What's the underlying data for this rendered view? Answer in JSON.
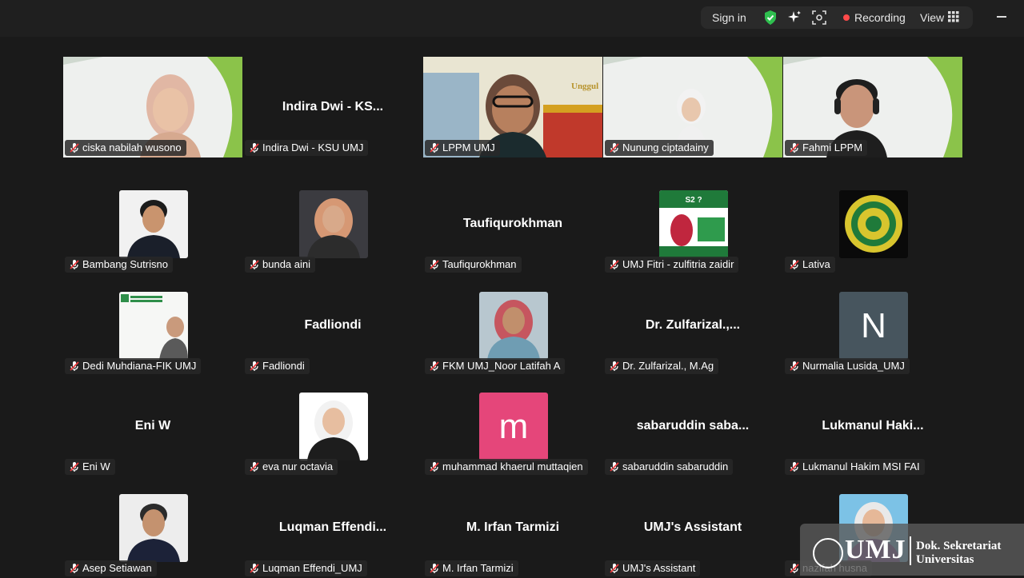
{
  "topbar": {
    "sign_in": "Sign in",
    "recording": "Recording",
    "view": "View"
  },
  "tiles": [
    {
      "name": "ciska nabilah wusono",
      "display": "video",
      "speaking": false
    },
    {
      "name": "Indira Dwi - KSU UMJ",
      "display": "text",
      "big": "Indira Dwi - KS..."
    },
    {
      "name": "LPPM UMJ",
      "display": "video",
      "speaking": true
    },
    {
      "name": "Nunung ciptadainy",
      "display": "video",
      "speaking": false
    },
    {
      "name": "Fahmi LPPM",
      "display": "video",
      "speaking": false
    },
    {
      "name": "Bambang Sutrisno",
      "display": "photo"
    },
    {
      "name": "bunda aini",
      "display": "photo"
    },
    {
      "name": "Taufiqurokhman",
      "display": "text",
      "big": "Taufiqurokhman"
    },
    {
      "name": "UMJ Fitri - zulfitria zaidir",
      "display": "photo"
    },
    {
      "name": "Lativa",
      "display": "photo"
    },
    {
      "name": "Dedi Muhdiana-FIK UMJ",
      "display": "photo"
    },
    {
      "name": "Fadliondi",
      "display": "text",
      "big": "Fadliondi"
    },
    {
      "name": "FKM UMJ_Noor Latifah A",
      "display": "photo"
    },
    {
      "name": "Dr. Zulfarizal., M.Ag",
      "display": "text",
      "big": "Dr. Zulfarizal.,..."
    },
    {
      "name": "Nurmalia Lusida_UMJ",
      "display": "letter",
      "letter": "N",
      "color": "#47555e"
    },
    {
      "name": "Eni W",
      "display": "text",
      "big": "Eni W"
    },
    {
      "name": "eva nur octavia",
      "display": "photo"
    },
    {
      "name": "muhammad khaerul muttaqien",
      "display": "letter",
      "letter": "m",
      "color": "#e5467a"
    },
    {
      "name": "sabaruddin sabaruddin",
      "display": "text",
      "big": "sabaruddin saba..."
    },
    {
      "name": "Lukmanul Hakim MSI FAI",
      "display": "text",
      "big": "Lukmanul Haki..."
    },
    {
      "name": "Asep Setiawan",
      "display": "photo"
    },
    {
      "name": "Luqman Effendi_UMJ",
      "display": "text",
      "big": "Luqman Effendi..."
    },
    {
      "name": "M. Irfan Tarmizi",
      "display": "text",
      "big": "M. Irfan Tarmizi"
    },
    {
      "name": "UMJ's Assistant",
      "display": "text",
      "big": "UMJ's Assistant"
    },
    {
      "name": "nazifah husna",
      "display": "photo"
    }
  ],
  "watermark": {
    "logo": "UMJ",
    "line1": "Dok. Sekretariat",
    "line2": "Universitas"
  }
}
